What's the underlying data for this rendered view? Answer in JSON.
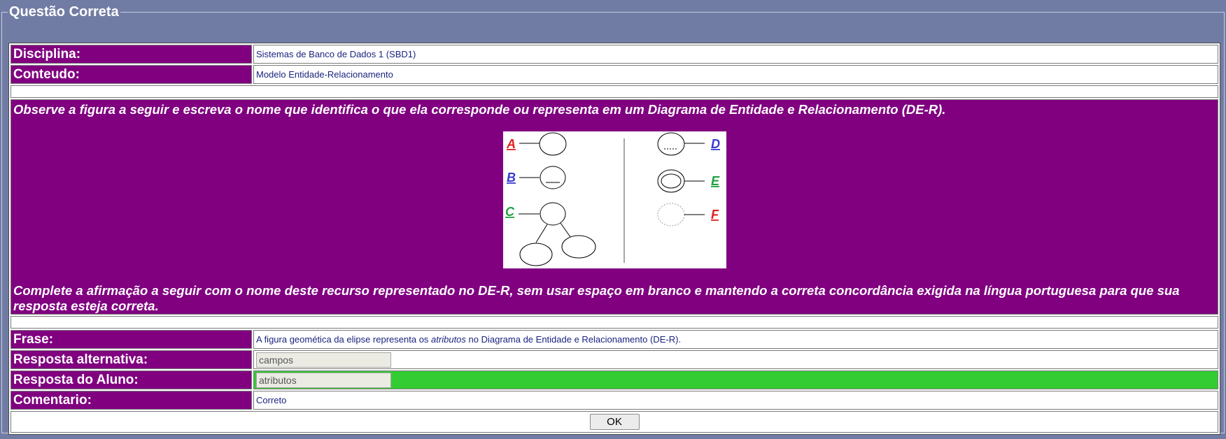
{
  "legend": "Questão Correta",
  "disciplina": {
    "label": "Disciplina:",
    "value": "Sistemas de Banco de Dados 1 (SBD1)"
  },
  "conteudo": {
    "label": "Conteudo:",
    "value": "Modelo Entidade-Relacionamento"
  },
  "question": {
    "intro": "Observe a figura a seguir e escreva o nome que identifica o que ela corresponde ou representa em um Diagrama de Entidade e Relacionamento (DE-R).",
    "instruction": "Complete a afirmação a seguir com o nome deste recurso representado no DE-R, sem usar espaço em branco e mantendo a correta concordância exigida na língua portuguesa para que sua resposta esteja correta.",
    "figure_labels": {
      "A": "A",
      "B": "B",
      "C": "C",
      "D": "D",
      "E": "E",
      "F": "F"
    },
    "figure_colors": {
      "A": "#e02020",
      "B": "#3a3ad0",
      "C": "#20a040",
      "D": "#3a3ad0",
      "E": "#20a040",
      "F": "#e02020"
    }
  },
  "frase": {
    "label": "Frase:",
    "before": "A figura geomética da elipse representa os ",
    "answer": "atributos",
    "after": " no Diagrama de Entidade e Relacionamento (DE-R)."
  },
  "resposta_alternativa": {
    "label": "Resposta alternativa:",
    "value": "campos"
  },
  "resposta_aluno": {
    "label": "Resposta do Aluno:",
    "value": "atributos",
    "status_color": "#33cc33"
  },
  "comentario": {
    "label": "Comentario:",
    "value": "Correto"
  },
  "ok_button": "OK"
}
